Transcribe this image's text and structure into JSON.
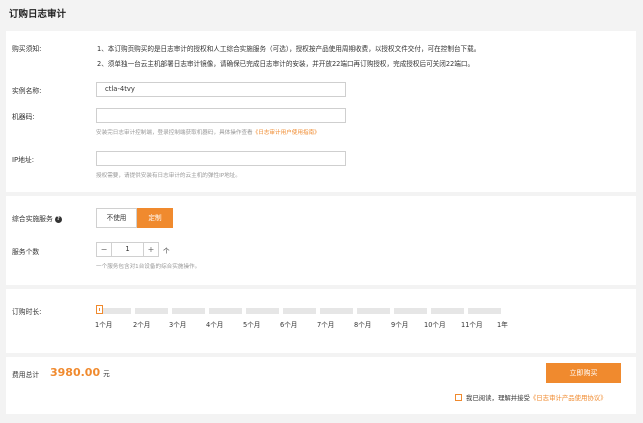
{
  "page_title": "订购日志审计",
  "notice": {
    "label": "购买须知:",
    "line1": "1、本订购页购买的是日志审计的授权和人工综合实施服务（可选），授权按产品使用周期收费，以授权文件交付，可在控制台下载。",
    "line2": "2、须单独一台云主机部署日志审计镜像，请确保已完成日志审计的安装，并开放22端口再订购授权，完成授权后可关闭22端口。"
  },
  "instance": {
    "label": "实例名称:",
    "value": "ctla-4tvy"
  },
  "machine_code": {
    "label": "机器码:",
    "value": "",
    "hint_prefix": "安装完日志审计控制端，登录控制端获取机器码，具体操作查看",
    "hint_link": "《日志审计用户使用指南》"
  },
  "ip": {
    "label": "IP地址:",
    "value": "",
    "hint": "授权需要，请提供安装有日志审计的云主机的弹性IP地址。"
  },
  "service": {
    "label": "综合实施服务",
    "help_icon": "?",
    "options": [
      "不使用",
      "定制"
    ],
    "selected": "定制"
  },
  "service_count": {
    "label": "服务个数",
    "minus": "−",
    "value": "1",
    "plus": "+",
    "unit": "个",
    "hint": "一个服务包含对1台设备的综合实施操作。"
  },
  "duration": {
    "label": "订购时长:",
    "ticks": [
      "1个月",
      "2个月",
      "3个月",
      "4个月",
      "5个月",
      "6个月",
      "7个月",
      "8个月",
      "9个月",
      "10个月",
      "11个月",
      "1年"
    ],
    "selected_index": 0
  },
  "total": {
    "label": "费用总计",
    "amount": "3980.00",
    "unit": "元"
  },
  "buy_button": "立即购买",
  "agreement": {
    "prefix": "我已阅读，理解并接受",
    "link": "《日志审计产品使用协议》"
  },
  "colors": {
    "accent": "#f08a2e",
    "background": "#f3f3f3",
    "panel": "#ffffff"
  }
}
